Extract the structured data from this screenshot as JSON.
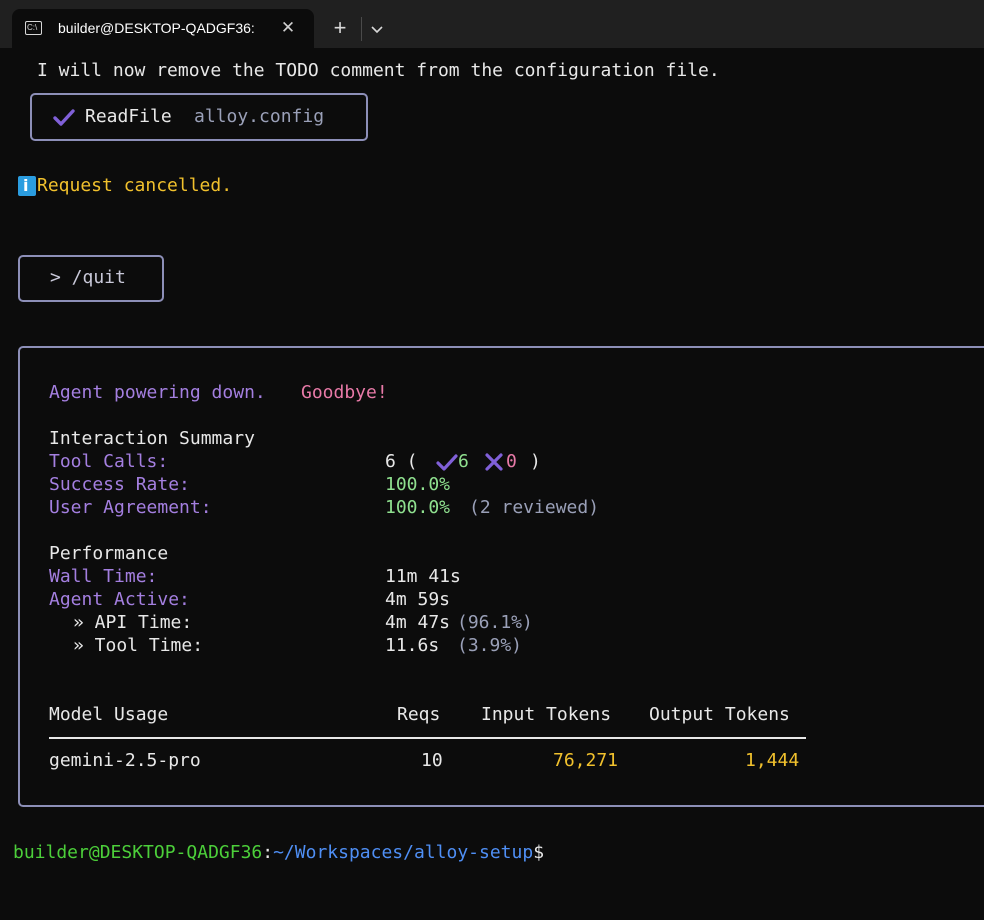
{
  "window": {
    "tab_title": "builder@DESKTOP-QADGF36:",
    "tab_icon": "terminal-icon",
    "tab_icon_text": "C:\\",
    "close_glyph": "✕",
    "new_tab_glyph": "+"
  },
  "log": {
    "message": "I will now remove the TODO comment from the configuration file.",
    "tool_name": "ReadFile",
    "tool_arg": "alloy.config",
    "info_text": "Request cancelled.",
    "quit_command": "> /quit"
  },
  "summary": {
    "farewell_part1": "Agent powering down.",
    "farewell_part2": "Goodbye!",
    "interaction_heading": "Interaction Summary",
    "tool_calls_label": "Tool Calls:",
    "tool_calls_total": "6 (",
    "tool_calls_success": "6",
    "tool_calls_fail": "0",
    "tool_calls_close": ")",
    "success_rate_label": "Success Rate:",
    "success_rate_value": "100.0%",
    "agreement_label": "User Agreement:",
    "agreement_value": "100.0%",
    "agreement_note": "(2 reviewed)",
    "performance_heading": "Performance",
    "wall_time_label": "Wall Time:",
    "wall_time_value": "11m 41s",
    "agent_active_label": "Agent Active:",
    "agent_active_value": "4m 59s",
    "api_time_label": "» API Time:",
    "api_time_value": "4m 47s",
    "api_time_pct": "(96.1%)",
    "tool_time_label": "» Tool Time:",
    "tool_time_value": "11.6s",
    "tool_time_pct": "(3.9%)"
  },
  "usage": {
    "headers": [
      "Model Usage",
      "Reqs",
      "Input Tokens",
      "Output Tokens"
    ],
    "row": {
      "model": "gemini-2.5-pro",
      "reqs": "10",
      "input_tokens": "76,271",
      "output_tokens": "1,444"
    }
  },
  "prompt": {
    "user_host": "builder@DESKTOP-QADGF36",
    "separator": ":",
    "path": "~/Workspaces/alloy-setup",
    "symbol": "$"
  },
  "colors": {
    "accent_purple": "#a47fe0",
    "success_green": "#8fe08f",
    "token_yellow": "#f1c12d",
    "info_yellow": "#f1c12d",
    "prompt_green": "#4ccf3a",
    "prompt_blue": "#4f8ff5",
    "border": "#8d8fb8"
  }
}
